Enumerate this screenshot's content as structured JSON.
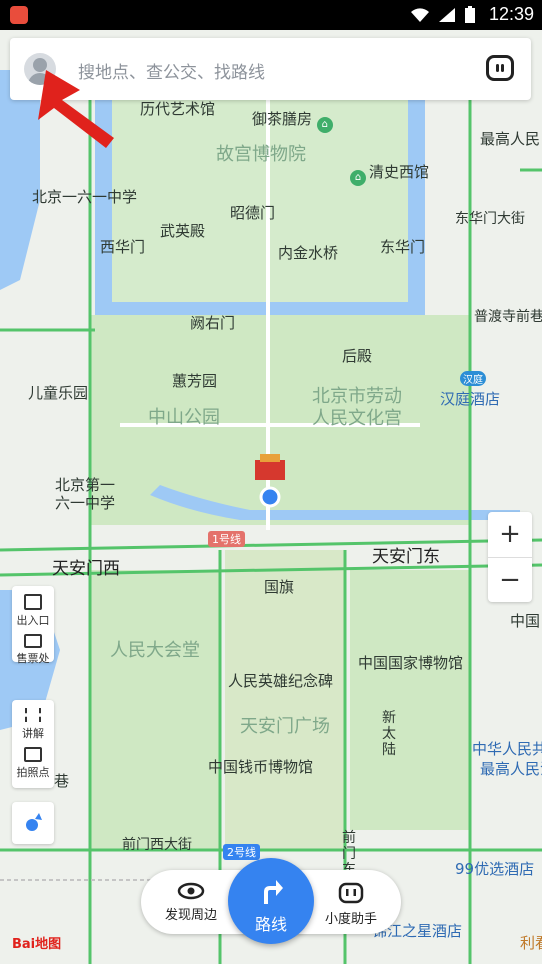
{
  "status_bar": {
    "time": "12:39"
  },
  "search": {
    "placeholder": "搜地点、查公交、找路线"
  },
  "map_labels": {
    "lidai_yishuguan": "历代艺术馆",
    "yucha_shanfang": "御茶膳房",
    "gugong": "故宫博物院",
    "qingshi_xiguan": "清史西馆",
    "zuigao_renmin": "最高人民",
    "beijing_161": "北京一六一中学",
    "wuyingdian": "武英殿",
    "zhaodemen": "昭德门",
    "donghuamen_dajie": "东华门大街",
    "xihuamen": "西华门",
    "neijinshuiqiao": "内金水桥",
    "donghuamen": "东华门",
    "puducisi": "普渡寺前巷",
    "queyoumen": "阙右门",
    "houdian": "后殿",
    "ertong_leyuan": "儿童乐园",
    "huifangyuan": "蕙芳园",
    "laodong_wenhuagong": "北京市劳动\n人民文化宫",
    "han_badge": "汉庭",
    "hanting_hotel": "汉庭酒店",
    "zhongshan_gongyuan": "中山公园",
    "beijing_dijiu": "北京第一\n六一中学",
    "line1": "1号线",
    "tiananmen_west": "天安门西",
    "tiananmen_east": "天安门东",
    "guoqi": "国旗",
    "zhong": "中国",
    "churukou": "出入口",
    "shoupiaochu": "售票处",
    "renmin_dahuitang": "人民大会堂",
    "guojia_bowuguan": "中国国家博物馆",
    "jinianbei": "人民英雄纪念碑",
    "jiangjie": "讲解",
    "paizhaodian": "拍照点",
    "xin_tai_lu": "新\n太\n陆",
    "tiananmen_square": "天安门广场",
    "xiang": "巷",
    "qianbi_bowuguan": "中国钱币博物馆",
    "zhonghua_renmin": "中华人民共",
    "zuigao_renmin_2": "最高人民法",
    "qianmen_xidajie": "前门西大街",
    "line2": "2号线",
    "qianmen": "前\n门\n东",
    "hotel99": "99优选酒店",
    "jinjiang": "锦江之星酒店",
    "li": "利看"
  },
  "bottom_bar": {
    "discover": "发现周边",
    "route": "路线",
    "assistant": "小度助手"
  },
  "zoom": {
    "in": "+",
    "out": "−"
  },
  "logo": {
    "text": "Bai地图"
  },
  "colors": {
    "water": "#9ec9f5",
    "park": "#cfe8c3",
    "road_green": "#54c46a",
    "route_blue": "#3583f0"
  }
}
